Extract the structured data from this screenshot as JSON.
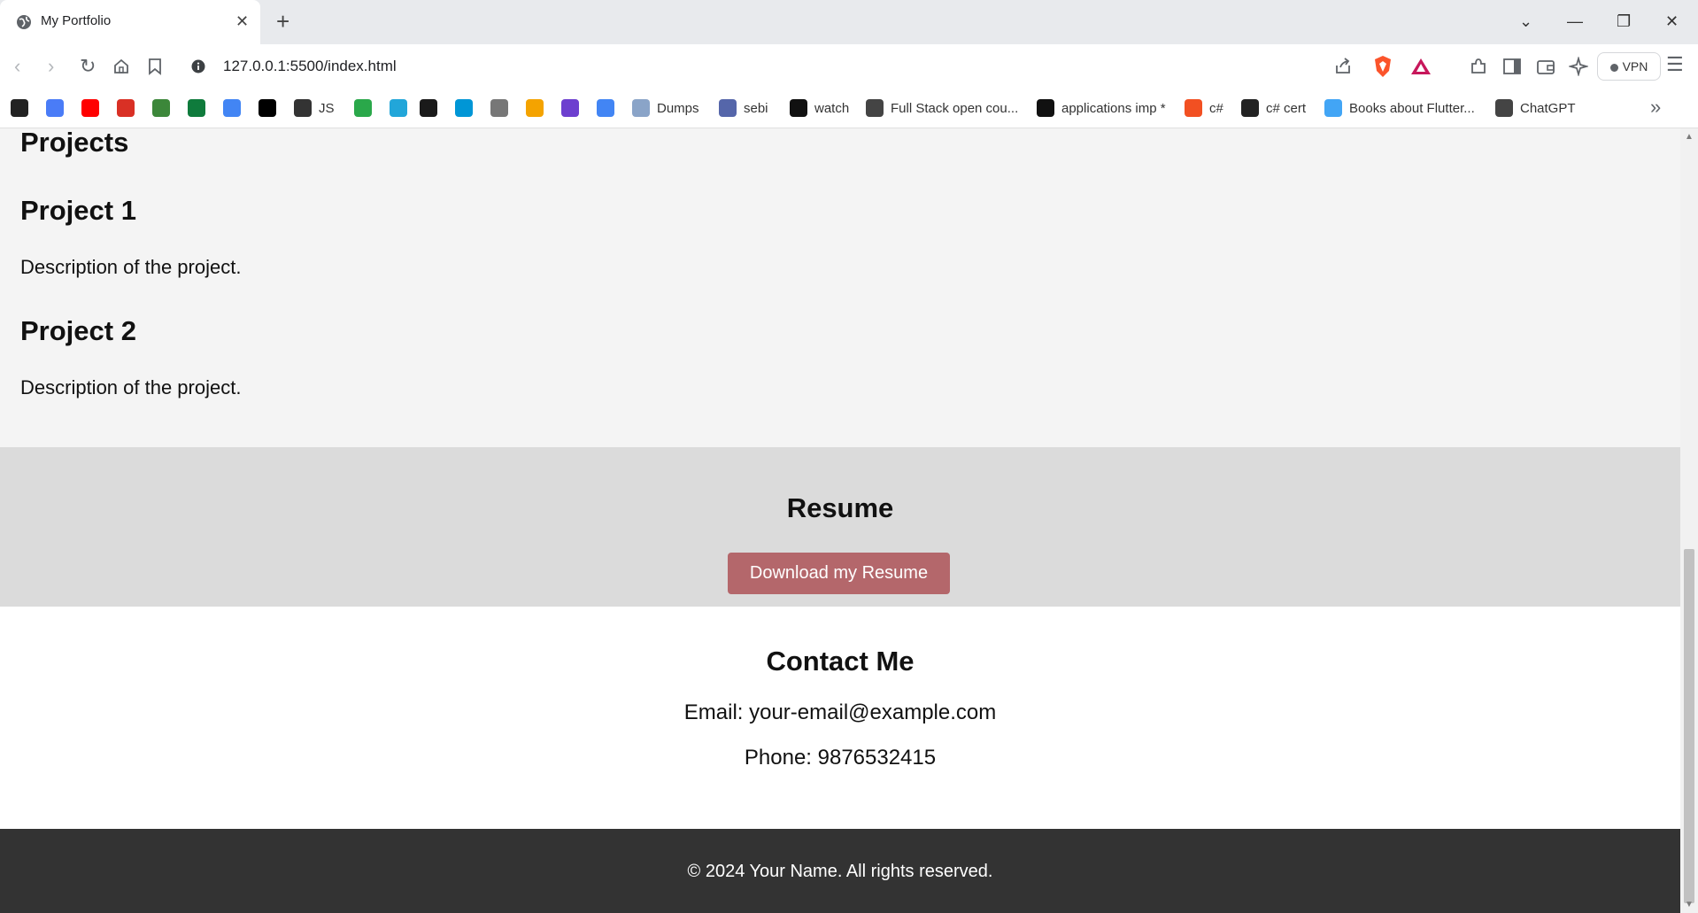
{
  "browser": {
    "tab_title": "My Portfolio",
    "url": "127.0.0.1:5500/index.html",
    "vpn_label": "VPN"
  },
  "bookmarks": [
    {
      "label": "",
      "icon": "github-icon",
      "color": "#222222"
    },
    {
      "label": "",
      "icon": "sparkle-icon",
      "color": "#4a7cf7"
    },
    {
      "label": "",
      "icon": "youtube-icon",
      "color": "#ff0000"
    },
    {
      "label": "",
      "icon": "gmail-icon",
      "color": "#d93025"
    },
    {
      "label": "",
      "icon": "nodejs-icon",
      "color": "#3c873a"
    },
    {
      "label": "",
      "icon": "mongodb-icon",
      "color": "#0f7b3c"
    },
    {
      "label": "",
      "icon": "google-icon",
      "color": "#4285f4"
    },
    {
      "label": "",
      "icon": "notion-icon",
      "color": "#000000"
    },
    {
      "label": "JS",
      "icon": "js-icon",
      "color": "#333333"
    },
    {
      "label": "",
      "icon": "freecodecamp-icon",
      "color": "#2aa84a"
    },
    {
      "label": "",
      "icon": "asterisk-icon",
      "color": "#22a6d9"
    },
    {
      "label": "",
      "icon": "terminal-icon",
      "color": "#1a1a1a"
    },
    {
      "label": "",
      "icon": "hp-icon",
      "color": "#0096d6"
    },
    {
      "label": "",
      "icon": "graduation-icon",
      "color": "#777777"
    },
    {
      "label": "",
      "icon": "chart-icon",
      "color": "#f4a300"
    },
    {
      "label": "",
      "icon": "circle-icon",
      "color": "#6d3fcf"
    },
    {
      "label": "",
      "icon": "cloud-icon",
      "color": "#4285f4"
    },
    {
      "label": "Dumps",
      "icon": "doc-icon",
      "color": "#8aa4c8"
    },
    {
      "label": "sebi",
      "icon": "sebi-icon",
      "color": "#5566aa"
    },
    {
      "label": "watch",
      "icon": "amazon-icon",
      "color": "#111111"
    },
    {
      "label": "Full Stack open cou...",
      "icon": "square-icon",
      "color": "#444444"
    },
    {
      "label": "applications imp *",
      "icon": "medium-icon",
      "color": "#111111"
    },
    {
      "label": "c#",
      "icon": "microsoft-icon",
      "color": "#f25022"
    },
    {
      "label": "c# cert",
      "icon": "cert-icon",
      "color": "#222222"
    },
    {
      "label": "Books about Flutter...",
      "icon": "flutter-icon",
      "color": "#42a5f5"
    },
    {
      "label": "ChatGPT",
      "icon": "chatgpt-icon",
      "color": "#444444"
    }
  ],
  "projects": {
    "heading": "Projects",
    "items": [
      {
        "title": "Project 1",
        "description": "Description of the project."
      },
      {
        "title": "Project 2",
        "description": "Description of the project."
      }
    ]
  },
  "resume": {
    "heading": "Resume",
    "button_label": "Download my Resume"
  },
  "contact": {
    "heading": "Contact Me",
    "email": "Email: your-email@example.com",
    "phone": "Phone: 9876532415"
  },
  "footer": {
    "text": "© 2024 Your Name. All rights reserved."
  },
  "colors": {
    "resume_button": "#b4676b",
    "footer_bg": "#333333",
    "projects_bg": "#f4f4f4",
    "resume_bg": "#dbdbdb"
  }
}
